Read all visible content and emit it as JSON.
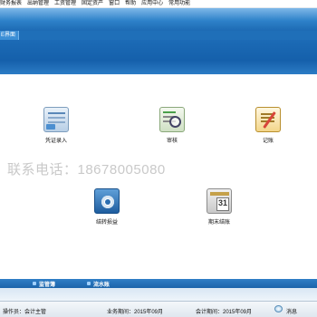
{
  "menubar": {
    "items": [
      "财务报表",
      "出纳管理",
      "工资管理",
      "固定资产",
      "窗口",
      "帮助",
      "应用中心",
      "常用功能"
    ]
  },
  "tab": {
    "label": "E界面"
  },
  "tools": {
    "voucher": "凭证录入",
    "audit": "审核",
    "post": "记账",
    "transfer": "结转损益",
    "closing": "期末结账",
    "closing_icon_text": "31"
  },
  "watermark": "联系电话：18678005080",
  "bottom_tabs": [
    "监管簿",
    "流水账"
  ],
  "status": {
    "operator": "操作员：会计主管",
    "business_period": "业务期间：2015年09月",
    "accounting_period": "会计期间：2015年09月",
    "message": "消息"
  }
}
